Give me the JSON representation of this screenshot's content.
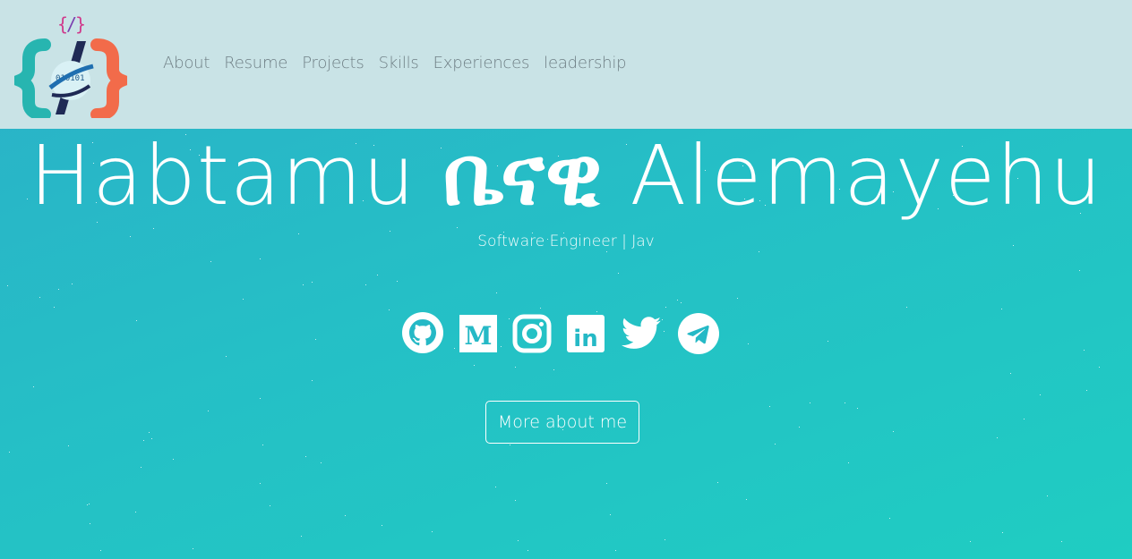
{
  "nav": {
    "items": [
      {
        "label": "About"
      },
      {
        "label": "Resume"
      },
      {
        "label": "Projects"
      },
      {
        "label": "Skills"
      },
      {
        "label": "Experiences"
      },
      {
        "label": "leadership"
      }
    ],
    "logo_text": "010101"
  },
  "hero": {
    "first_name": "Habtamu",
    "amharic_name": "ቤናዊ",
    "last_name": "Alemayehu",
    "subtitle": "Software Engineer | Jav",
    "cta_label": "More about me"
  },
  "socials": [
    {
      "icon": "github-icon"
    },
    {
      "icon": "medium-icon",
      "glyph": "M"
    },
    {
      "icon": "instagram-icon"
    },
    {
      "icon": "linkedin-icon",
      "glyph": "in"
    },
    {
      "icon": "twitter-icon"
    },
    {
      "icon": "telegram-icon"
    }
  ],
  "colors": {
    "navbar_bg": "#c9e3e6",
    "hero_bg_start": "#2bb0c8",
    "hero_bg_end": "#1fcdc2",
    "nav_text": "#6f7f85",
    "logo_teal": "#27b5b0",
    "logo_orange": "#f26b4a",
    "logo_navy": "#1f2a55"
  }
}
